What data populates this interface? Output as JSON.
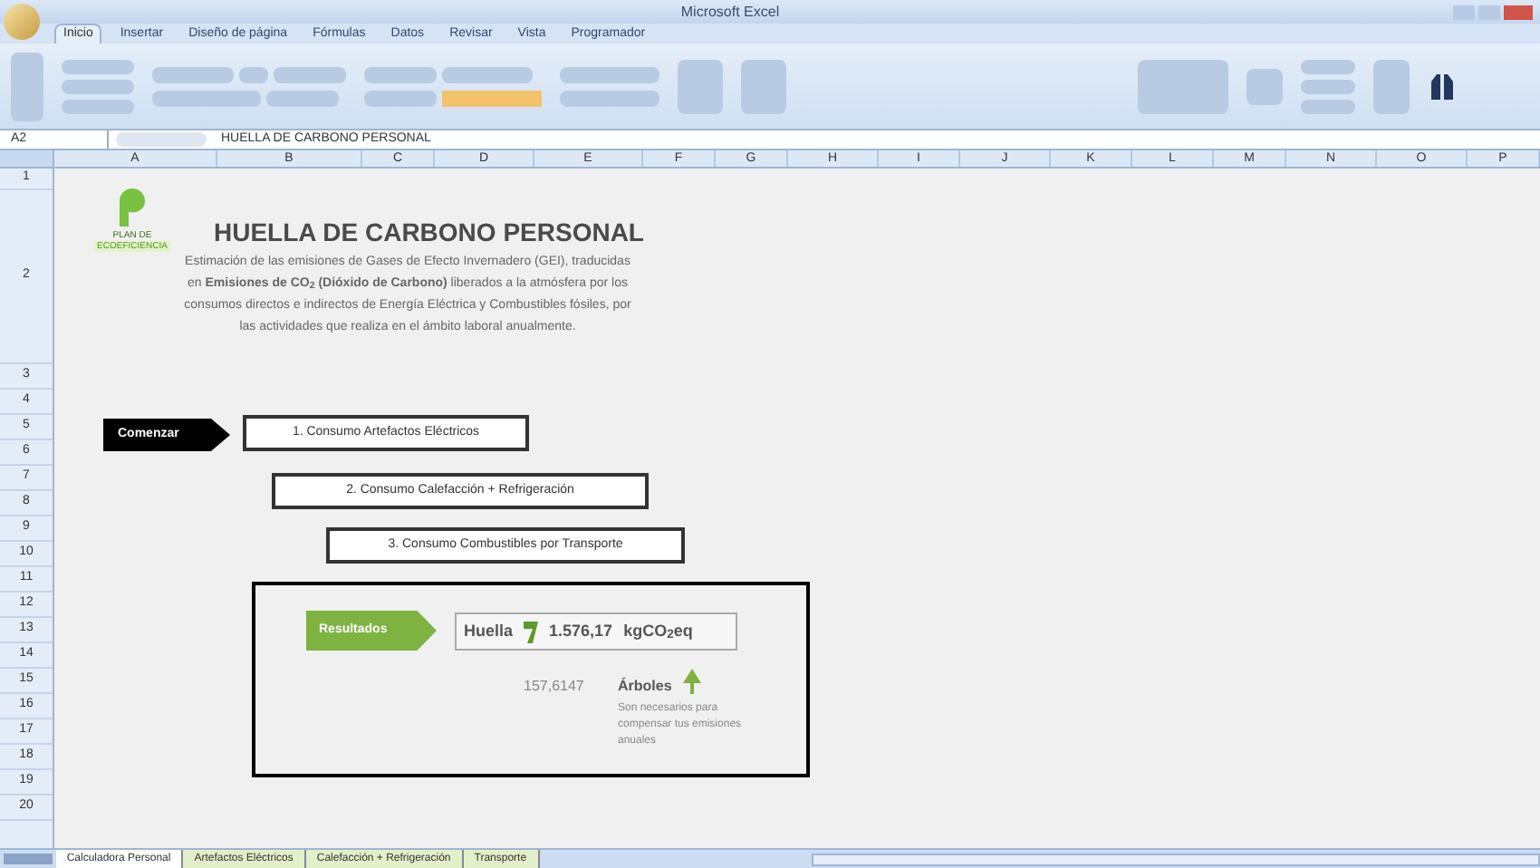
{
  "window": {
    "title": "Microsoft Excel"
  },
  "ribbon_tabs": [
    {
      "label": "Inicio",
      "selected": true
    },
    {
      "label": "Insertar",
      "selected": false
    },
    {
      "label": "Diseño de página",
      "selected": false
    },
    {
      "label": "Fórmulas",
      "selected": false
    },
    {
      "label": "Datos",
      "selected": false
    },
    {
      "label": "Revisar",
      "selected": false
    },
    {
      "label": "Vista",
      "selected": false
    },
    {
      "label": "Programador",
      "selected": false
    }
  ],
  "formula_bar": {
    "cell": "A2",
    "value": "HUELLA DE CARBONO PERSONAL"
  },
  "columns": [
    "A",
    "B",
    "C",
    "D",
    "E",
    "F",
    "G",
    "H",
    "I",
    "J",
    "K",
    "L",
    "M",
    "N",
    "O",
    "P"
  ],
  "rows": [
    "1",
    "2",
    "3",
    "4",
    "5",
    "6",
    "7",
    "8",
    "9",
    "10",
    "11",
    "12",
    "13",
    "14",
    "15",
    "16",
    "17",
    "18",
    "19",
    "20"
  ],
  "sheet": {
    "logo": {
      "line1": "PLAN DE",
      "line2": "ECOEFICIENCIA"
    },
    "title": "HUELLA DE CARBONO PERSONAL",
    "description": "Estimación de las emisiones de Gases de Efecto Invernadero (GEI), traducidas en **Emisiones de CO$_{2}$ (Dióxido de Carbono)** liberados a la atmósfera por los consumos directos e indirectos de Energía Eléctrica y Combustibles fósiles, por las actividades que realiza en el ámbito laboral anualmente.",
    "start_button": "Comenzar",
    "steps": [
      "1. Consumo Artefactos Eléctricos",
      "2. Consumo Calefacción + Refrigeración",
      "3. Consumo Combustibles por Transporte"
    ],
    "results": {
      "label": "Resultados",
      "footprint_label": "Huella",
      "footprint_value": "1.576,17",
      "footprint_unit": "kgCO$_{2}$eq",
      "trees_value": "157,6147",
      "trees_label": "Árboles",
      "trees_note": "Son necesarios para compensar tus emisiones anuales"
    }
  },
  "sheet_tabs": [
    {
      "label": "Calculadora Personal",
      "selected": true
    },
    {
      "label": "Artefactos Eléctricos",
      "selected": false
    },
    {
      "label": "Calefacción + Refrigeración",
      "selected": false
    },
    {
      "label": "Transporte",
      "selected": false
    }
  ]
}
